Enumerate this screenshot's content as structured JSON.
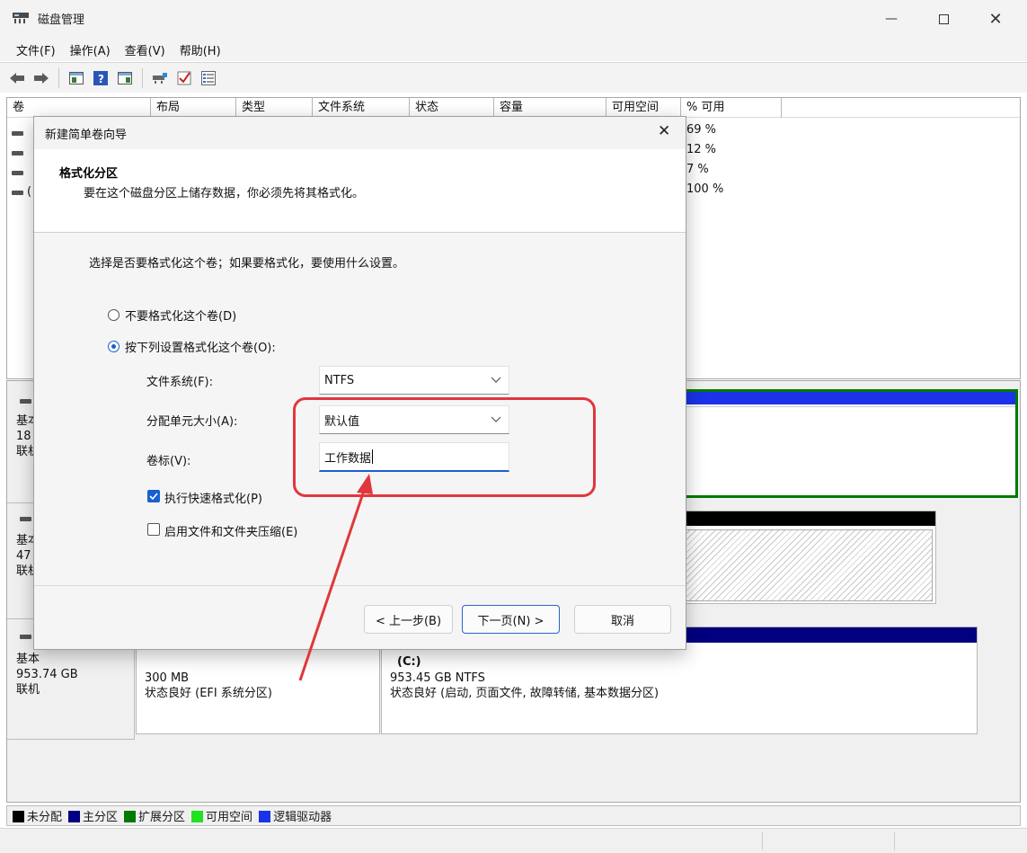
{
  "window": {
    "title": "磁盘管理",
    "minimize_icon": "minimize-icon",
    "maximize_icon": "maximize-icon",
    "close_icon": "close-icon"
  },
  "menu": [
    "文件(F)",
    "操作(A)",
    "查看(V)",
    "帮助(H)"
  ],
  "toolbar": {
    "icons": [
      "back-arrow-icon",
      "forward-arrow-icon",
      "console-tree-icon",
      "help-icon",
      "action-pane-icon",
      "connect-disk-icon",
      "check-icon",
      "properties-list-icon"
    ]
  },
  "volume_list": {
    "columns": [
      "卷",
      "布局",
      "类型",
      "文件系统",
      "状态",
      "容量",
      "可用空间",
      "% 可用"
    ],
    "rows": [
      {
        "pct": "69 %"
      },
      {
        "pct": "12 %"
      },
      {
        "pct": "7 %"
      },
      {
        "name_partial": "(",
        "pct": "100 %"
      }
    ]
  },
  "disks": [
    {
      "type_partial": "基本",
      "size_partial": "18",
      "status_partial": "联机"
    },
    {
      "type_partial": "基本",
      "size_partial": "47",
      "status_partial": "联机"
    },
    {
      "type": "基本",
      "size": "953.74 GB",
      "status": "联机",
      "partitions": [
        {
          "name": "",
          "size": "300 MB",
          "status": "状态良好 (EFI 系统分区)"
        },
        {
          "name": "(C:)",
          "size": "953.45 GB NTFS",
          "status": "状态良好 (启动, 页面文件, 故障转储, 基本数据分区)"
        }
      ]
    }
  ],
  "legend": [
    {
      "label": "未分配",
      "color": "#000000"
    },
    {
      "label": "主分区",
      "color": "#000080"
    },
    {
      "label": "扩展分区",
      "color": "#007a00"
    },
    {
      "label": "可用空间",
      "color": "#22e022"
    },
    {
      "label": "逻辑驱动器",
      "color": "#1b32e8"
    }
  ],
  "wizard": {
    "title": "新建简单卷向导",
    "header_title": "格式化分区",
    "header_subtitle": "要在这个磁盘分区上储存数据，你必须先将其格式化。",
    "instruction": "选择是否要格式化这个卷；如果要格式化，要使用什么设置。",
    "radio_no_format": "不要格式化这个卷(D)",
    "radio_format": "按下列设置格式化这个卷(O):",
    "filesystem_label": "文件系统(F):",
    "filesystem_value": "NTFS",
    "alloc_label": "分配单元大小(A):",
    "alloc_value": "默认值",
    "volume_label_label": "卷标(V):",
    "volume_label_value": "工作数据",
    "quick_format": "执行快速格式化(P)",
    "quick_format_checked": true,
    "compression": "启用文件和文件夹压缩(E)",
    "compression_checked": false,
    "back_button": "< 上一步(B)",
    "next_button": "下一页(N) >",
    "cancel_button": "取消"
  },
  "colors": {
    "accent": "#1a5fd0",
    "annotation": "#e0373e",
    "primary_partition": "#000080",
    "unallocated": "#000000",
    "logical_drive": "#1b32e8",
    "free_space_border": "#007a00"
  }
}
